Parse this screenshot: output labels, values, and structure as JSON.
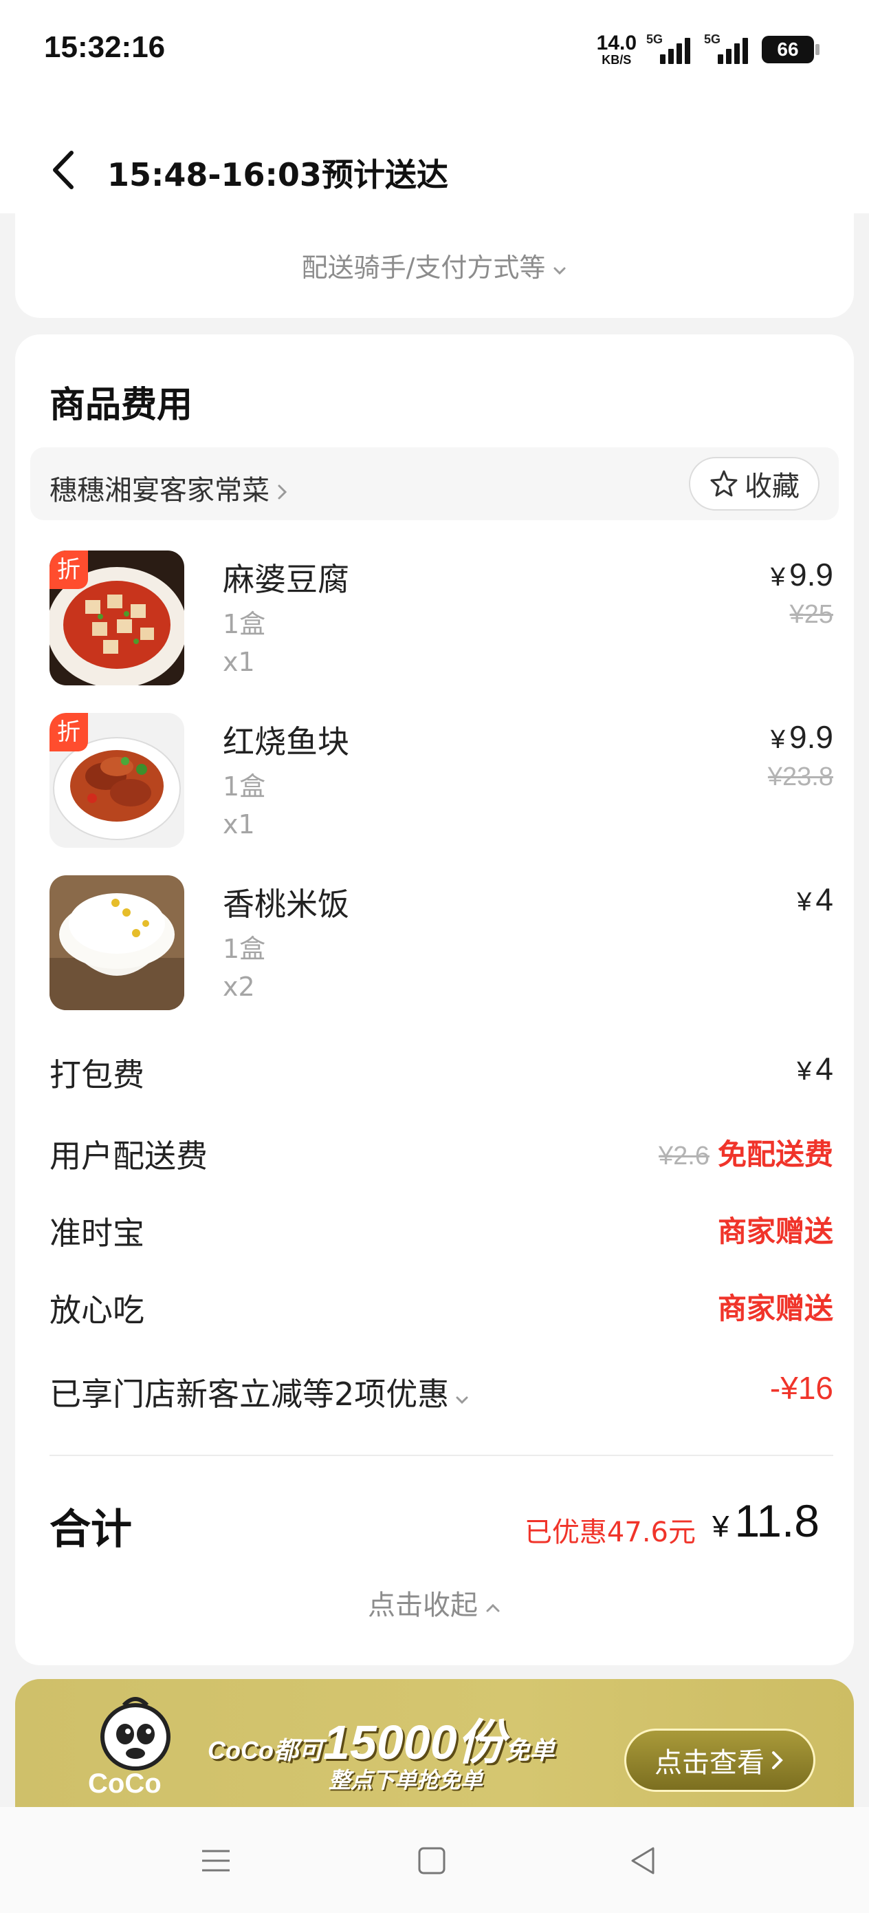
{
  "status_bar": {
    "time": "15:32:16",
    "net_speed_value": "14.0",
    "net_speed_unit": "KB/S",
    "sim1_label": "5G",
    "sim2_label": "5G",
    "battery": "66"
  },
  "header": {
    "title": "15:48-16:03预计送达"
  },
  "delivery_card": {
    "more_link": "配送骑手/支付方式等"
  },
  "goods": {
    "section_title": "商品费用",
    "shop_name": "穗穗湘宴客家常菜",
    "favorite_label": "收藏",
    "currency": "¥",
    "discount_tag": "折",
    "items": [
      {
        "name": "麻婆豆腐",
        "spec": "1盒",
        "qty": "x1",
        "price": "9.9",
        "original_price": "¥25",
        "has_discount": true
      },
      {
        "name": "红烧鱼块",
        "spec": "1盒",
        "qty": "x1",
        "price": "9.9",
        "original_price": "¥23.8",
        "has_discount": true
      },
      {
        "name": "香桃米饭",
        "spec": "1盒",
        "qty": "x2",
        "price": "4",
        "original_price": "",
        "has_discount": false
      }
    ],
    "fees": {
      "packing_label": "打包费",
      "packing_value": "4",
      "delivery_label": "用户配送费",
      "delivery_original": "¥2.6",
      "delivery_value": "免配送费",
      "ontime_label": "准时宝",
      "ontime_value": "商家赠送",
      "safe_label": "放心吃",
      "safe_value": "商家赠送",
      "promo_label": "已享门店新客立减等2项优惠",
      "promo_value": "-¥16"
    },
    "total": {
      "label": "合计",
      "discount_text": "已优惠47.6元",
      "value": "11.8"
    },
    "collapse_label": "点击收起"
  },
  "banner": {
    "brand": "CoCo",
    "title_prefix": "CoCo都可",
    "title_number": "15000份",
    "title_suffix": "免单",
    "subtitle": "整点下单抢免单",
    "button": "点击查看"
  },
  "colors": {
    "accent_red": "#f0342a",
    "banner_gold": "#cfc06a"
  },
  "icons": {
    "back": "back-arrow-icon",
    "star": "star-outline-icon",
    "menu": "menu-icon",
    "home": "home-square-icon",
    "nav_back": "triangle-back-icon"
  }
}
